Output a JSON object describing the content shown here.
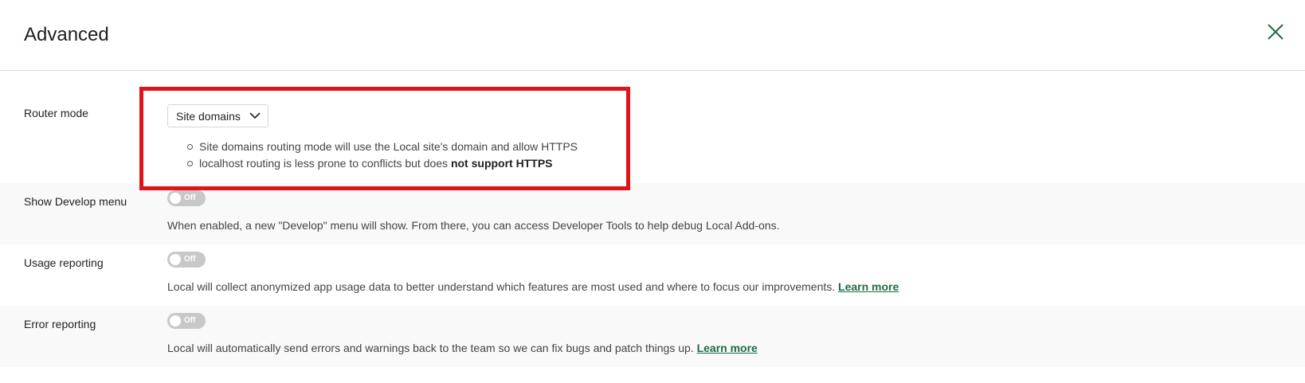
{
  "header": {
    "title": "Advanced"
  },
  "router": {
    "label": "Router mode",
    "selected": "Site domains",
    "bullets": [
      {
        "text": "Site domains routing mode will use the Local site's domain and allow HTTPS",
        "bold": ""
      },
      {
        "text": "localhost routing is less prone to conflicts but does ",
        "bold": "not support HTTPS"
      }
    ]
  },
  "develop": {
    "label": "Show Develop menu",
    "toggle": "Off",
    "description": "When enabled, a new \"Develop\" menu will show. From there, you can access Developer Tools to help debug Local Add-ons."
  },
  "usage": {
    "label": "Usage reporting",
    "toggle": "Off",
    "description": "Local will collect anonymized app usage data to better understand which features are most used and where to focus our improvements.",
    "link": "Learn more"
  },
  "errors": {
    "label": "Error reporting",
    "toggle": "Off",
    "description": "Local will automatically send errors and warnings back to the team so we can fix bugs and patch things up.",
    "link": "Learn more"
  },
  "colors": {
    "accent": "#1f6b46",
    "highlight": "#e0121a",
    "toggle_off": "#c8c8c8"
  }
}
